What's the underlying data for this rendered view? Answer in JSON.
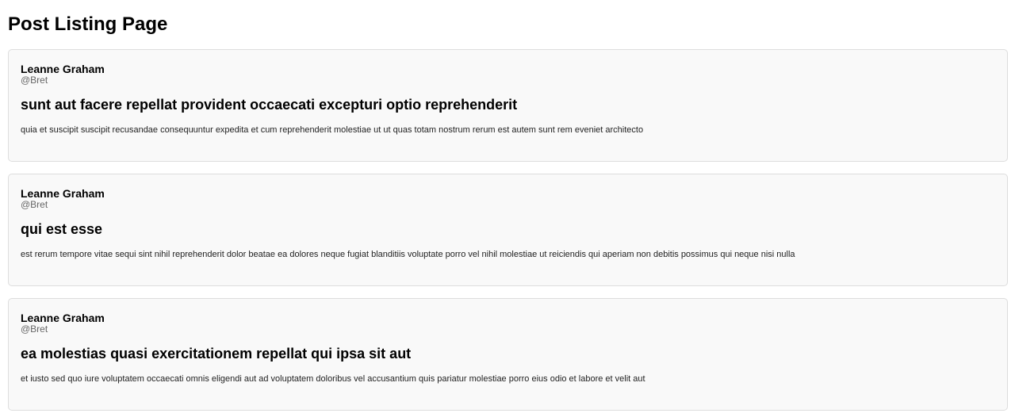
{
  "page": {
    "title": "Post Listing Page"
  },
  "posts": [
    {
      "author_name": "Leanne Graham",
      "author_handle": "@Bret",
      "title": "sunt aut facere repellat provident occaecati excepturi optio reprehenderit",
      "body": "quia et suscipit suscipit recusandae consequuntur expedita et cum reprehenderit molestiae ut ut quas totam nostrum rerum est autem sunt rem eveniet architecto"
    },
    {
      "author_name": "Leanne Graham",
      "author_handle": "@Bret",
      "title": "qui est esse",
      "body": "est rerum tempore vitae sequi sint nihil reprehenderit dolor beatae ea dolores neque fugiat blanditiis voluptate porro vel nihil molestiae ut reiciendis qui aperiam non debitis possimus qui neque nisi nulla"
    },
    {
      "author_name": "Leanne Graham",
      "author_handle": "@Bret",
      "title": "ea molestias quasi exercitationem repellat qui ipsa sit aut",
      "body": "et iusto sed quo iure voluptatem occaecati omnis eligendi aut ad voluptatem doloribus vel accusantium quis pariatur molestiae porro eius odio et labore et velit aut"
    }
  ],
  "colors": {
    "card_background": "#f9f9f9",
    "card_border": "#dddddd",
    "handle_text": "#666666"
  }
}
